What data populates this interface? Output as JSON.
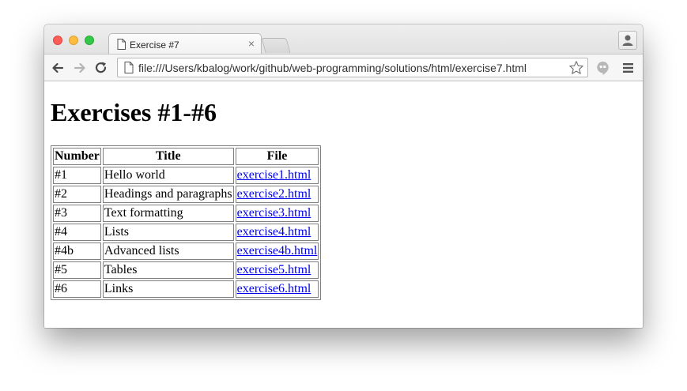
{
  "browser": {
    "tab": {
      "title": "Exercise #7",
      "close": "×"
    },
    "url": "file:///Users/kbalog/work/github/web-programming/solutions/html/exercise7.html"
  },
  "page": {
    "heading": "Exercises #1-#6",
    "table": {
      "headers": [
        "Number",
        "Title",
        "File"
      ],
      "rows": [
        [
          "#1",
          "Hello world",
          "exercise1.html"
        ],
        [
          "#2",
          "Headings and paragraphs",
          "exercise2.html"
        ],
        [
          "#3",
          "Text formatting",
          "exercise3.html"
        ],
        [
          "#4",
          "Lists",
          "exercise4.html"
        ],
        [
          "#4b",
          "Advanced lists",
          "exercise4b.html"
        ],
        [
          "#5",
          "Tables",
          "exercise5.html"
        ],
        [
          "#6",
          "Links",
          "exercise6.html"
        ]
      ]
    }
  },
  "icons": {
    "back": "back-arrow-icon",
    "forward": "forward-arrow-icon",
    "reload": "reload-icon",
    "page": "page-icon",
    "star": "star-icon",
    "extension": "hangouts-icon",
    "menu": "hamburger-menu-icon",
    "profile": "profile-icon"
  },
  "colors": {
    "close": "#fc5d57",
    "minimize": "#fdbc40",
    "maximize": "#34c84a",
    "link": "#0000ee"
  }
}
